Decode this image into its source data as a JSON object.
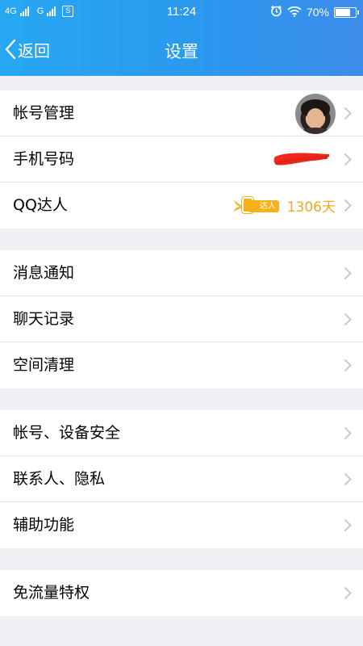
{
  "status_bar": {
    "network_1": "4G",
    "network_2": "G",
    "sim_icon_text": "S",
    "time": "11:24",
    "battery_text": "70%",
    "battery_level": 0.7,
    "icons": [
      "signal-icon",
      "alarm-icon",
      "wifi-icon",
      "battery-icon"
    ]
  },
  "nav": {
    "back_label": "返回",
    "title": "设置"
  },
  "accent_color": "#2a99ef",
  "groups": [
    {
      "items": [
        {
          "label": "帐号管理",
          "trailing": "avatar"
        },
        {
          "label": "手机号码",
          "trailing": "redacted"
        },
        {
          "label": "QQ达人",
          "badge_text": "达人",
          "days": "1306天",
          "badge_color": "#f7b21a"
        }
      ]
    },
    {
      "items": [
        {
          "label": "消息通知"
        },
        {
          "label": "聊天记录"
        },
        {
          "label": "空间清理"
        }
      ]
    },
    {
      "items": [
        {
          "label": "帐号、设备安全"
        },
        {
          "label": "联系人、隐私"
        },
        {
          "label": "辅助功能"
        }
      ]
    },
    {
      "items": [
        {
          "label": "免流量特权"
        }
      ]
    }
  ]
}
